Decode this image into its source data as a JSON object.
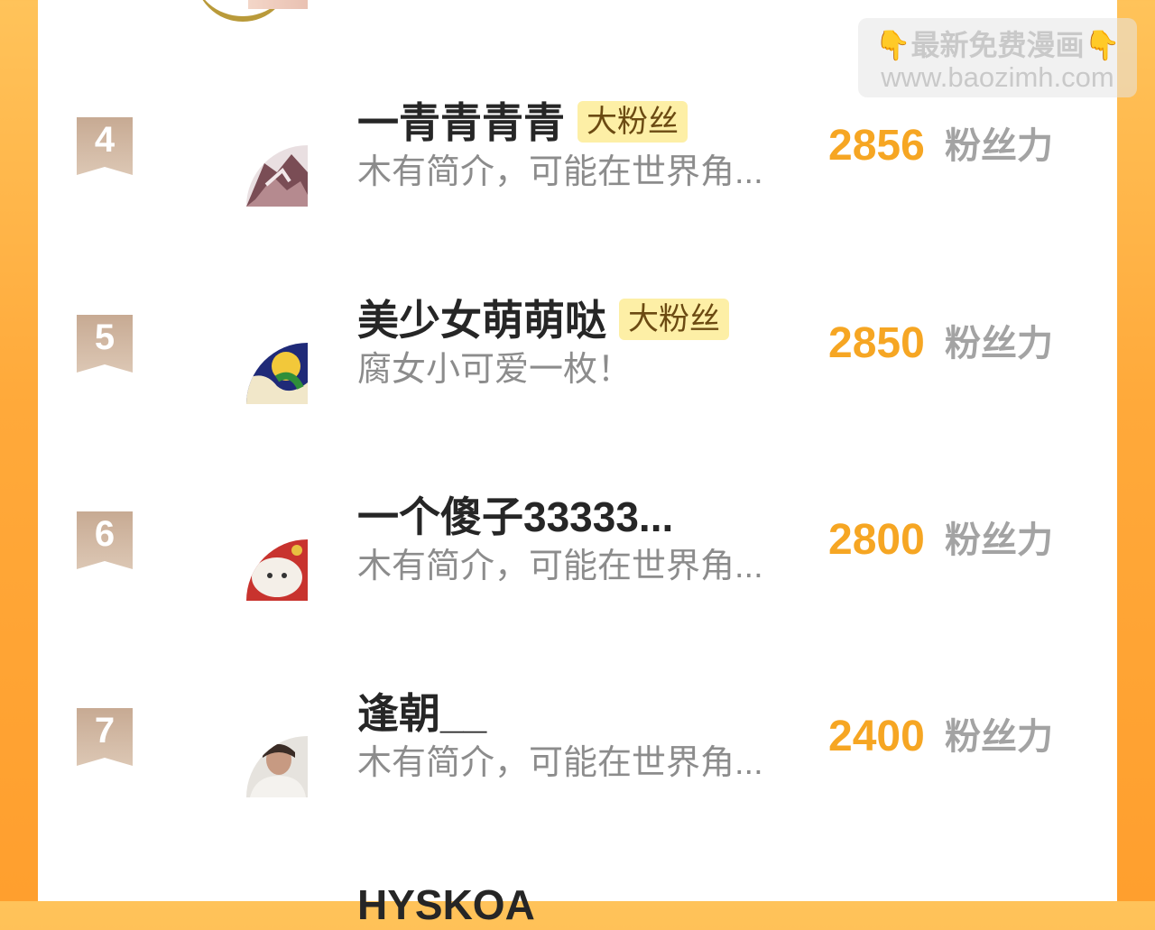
{
  "watermark": {
    "line1_hand_left": "👇",
    "line1_text": "最新免费漫画",
    "line1_hand_right": "👇",
    "line2": "www.baozimh.com"
  },
  "list": [
    {
      "rank": "4",
      "name": "一青青青青",
      "badge": "大粉丝",
      "bio": "木有简介，可能在世界角...",
      "score": "2856",
      "unit": "粉丝力"
    },
    {
      "rank": "5",
      "name": "美少女萌萌哒",
      "badge": "大粉丝",
      "bio": "腐女小可爱一枚！",
      "score": "2850",
      "unit": "粉丝力"
    },
    {
      "rank": "6",
      "name": "一个傻子33333...",
      "badge": "",
      "bio": "木有简介，可能在世界角...",
      "score": "2800",
      "unit": "粉丝力"
    },
    {
      "rank": "7",
      "name": "逢朝__",
      "badge": "",
      "bio": "木有简介，可能在世界角...",
      "score": "2400",
      "unit": "粉丝力"
    }
  ],
  "next_partial_name": "HYSKOA",
  "colors": {
    "score": "#f6a623",
    "badge_bg": "#fdefa6",
    "rank_tag": "#c7aa93",
    "side_bg": "#ffa93a"
  }
}
